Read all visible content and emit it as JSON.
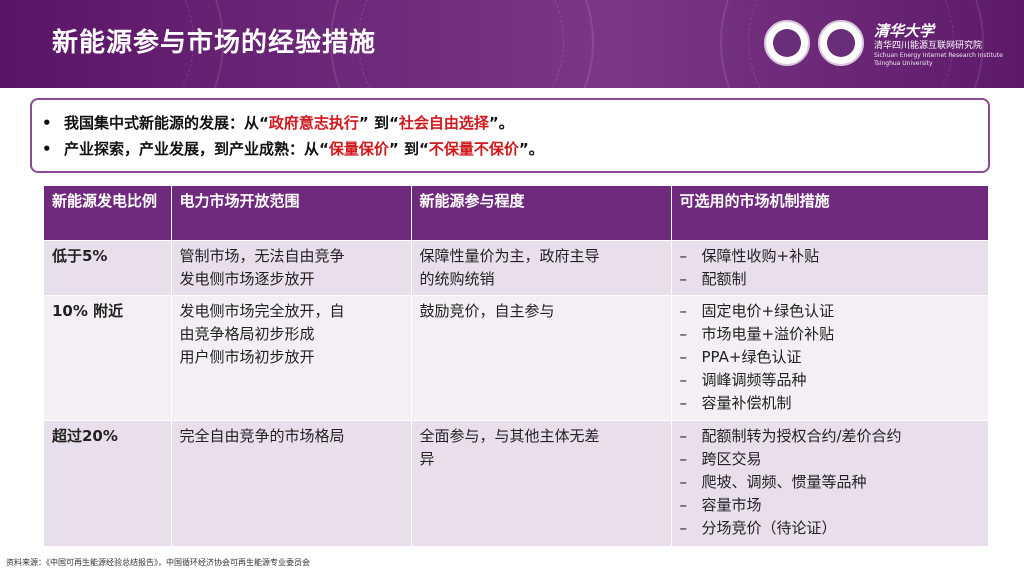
{
  "header": {
    "title": "新能源参与市场的经验措施",
    "org_cn_title": "清华大学",
    "org_cn": "清华四川能源互联网研究院",
    "org_en": "Sichuan Energy Internet Research Institute",
    "org_en2": "Tsinghua University",
    "bg_color": "#6e2a7a"
  },
  "bullets": [
    {
      "pre": "我国集中式新能源的发展：从“",
      "hl1": "政府意志执行",
      "mid": "” 到“",
      "hl2": "社会自由选择",
      "post": "”。"
    },
    {
      "pre": "产业探索，产业发展，到产业成熟：从“",
      "hl1": "保量保价",
      "mid": "” 到“",
      "hl2": "不保量不保价",
      "post": "”。"
    }
  ],
  "table": {
    "headers": [
      "新能源发电比例",
      "电力市场开放范围",
      "新能源参与程度",
      "可选用的市场机制措施"
    ],
    "rows": [
      {
        "level": "低于5%",
        "market": [
          "管制市场，无法自由竞争",
          "发电侧市场逐步放开"
        ],
        "participation": [
          "保障性量价为主，政府主导",
          "的统购统销"
        ],
        "measures": [
          "保障性收购+补贴",
          "配额制"
        ]
      },
      {
        "level": "10% 附近",
        "market": [
          "发电侧市场完全放开，自",
          "由竞争格局初步形成",
          "用户侧市场初步放开"
        ],
        "participation": [
          "鼓励竞价，自主参与"
        ],
        "measures": [
          "固定电价+绿色认证",
          "市场电量+溢价补贴",
          "PPA+绿色认证",
          "调峰调频等品种",
          "容量补偿机制"
        ]
      },
      {
        "level": "超过20%",
        "market": [
          "完全自由竞争的市场格局"
        ],
        "participation": [
          "全面参与，与其他主体无差",
          "异"
        ],
        "measures": [
          "配额制转为授权合约/差价合约",
          "跨区交易",
          "爬坡、调频、惯量等品种",
          "容量市场",
          "分场竞价（待论证）"
        ]
      }
    ],
    "header_color": "#6f2a7d",
    "row_color_a": "#e9dfec",
    "row_color_b": "#f4eef5"
  },
  "source": "资料来源：《中国可再生能源经验总结报告》，中国循环经济协会可再生能源专业委员会",
  "highlight_color": "#d0181d"
}
